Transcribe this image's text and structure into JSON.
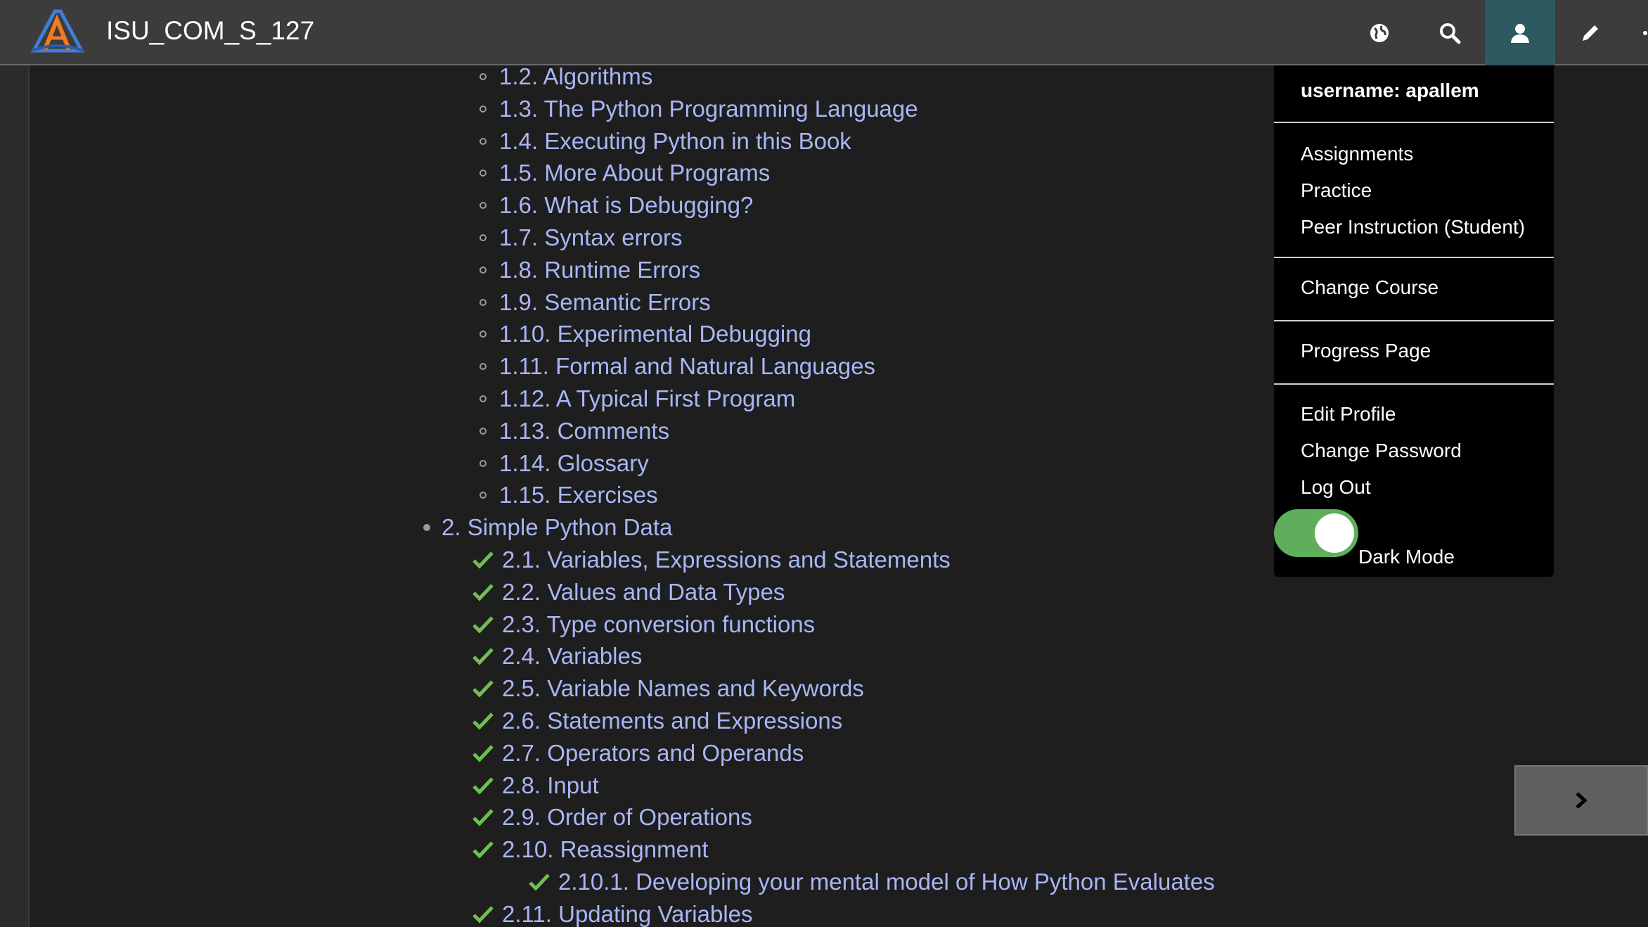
{
  "navbar": {
    "title": "ISU_COM_S_127",
    "icons": [
      "globe-icon",
      "search-icon",
      "user-icon",
      "pencil-icon",
      "moon-icon"
    ]
  },
  "toc": {
    "rows": [
      {
        "kind": "circle",
        "label": "1.2. Algorithms"
      },
      {
        "kind": "circle",
        "label": "1.3. The Python Programming Language"
      },
      {
        "kind": "circle",
        "label": "1.4. Executing Python in this Book"
      },
      {
        "kind": "circle",
        "label": "1.5. More About Programs"
      },
      {
        "kind": "circle",
        "label": "1.6. What is Debugging?"
      },
      {
        "kind": "circle",
        "label": "1.7. Syntax errors"
      },
      {
        "kind": "circle",
        "label": "1.8. Runtime Errors"
      },
      {
        "kind": "circle",
        "label": "1.9. Semantic Errors"
      },
      {
        "kind": "circle",
        "label": "1.10. Experimental Debugging"
      },
      {
        "kind": "circle",
        "label": "1.11. Formal and Natural Languages"
      },
      {
        "kind": "circle",
        "label": "1.12. A Typical First Program"
      },
      {
        "kind": "circle",
        "label": "1.13. Comments"
      },
      {
        "kind": "circle",
        "label": "1.14. Glossary"
      },
      {
        "kind": "circle",
        "label": "1.15. Exercises"
      },
      {
        "kind": "bullet",
        "label": "2. Simple Python Data"
      },
      {
        "kind": "check",
        "label": "2.1. Variables, Expressions and Statements"
      },
      {
        "kind": "check",
        "label": "2.2. Values and Data Types"
      },
      {
        "kind": "check",
        "label": "2.3. Type conversion functions"
      },
      {
        "kind": "check",
        "label": "2.4. Variables"
      },
      {
        "kind": "check",
        "label": "2.5. Variable Names and Keywords"
      },
      {
        "kind": "check",
        "label": "2.6. Statements and Expressions"
      },
      {
        "kind": "check",
        "label": "2.7. Operators and Operands"
      },
      {
        "kind": "check",
        "label": "2.8. Input"
      },
      {
        "kind": "check",
        "label": "2.9. Order of Operations"
      },
      {
        "kind": "check",
        "label": "2.10. Reassignment"
      },
      {
        "kind": "check2",
        "label": "2.10.1. Developing your mental model of How Python Evaluates"
      },
      {
        "kind": "check",
        "label": "2.11. Updating Variables"
      }
    ]
  },
  "dropdown": {
    "username": "username: apallem",
    "assignments": "Assignments",
    "practice": "Practice",
    "peer_instruction": "Peer Instruction (Student)",
    "change_course": "Change Course",
    "progress_page": "Progress Page",
    "edit_profile": "Edit Profile",
    "change_password": "Change Password",
    "log_out": "Log Out",
    "dark_mode": "Dark Mode",
    "dark_mode_on": true
  },
  "colors": {
    "link": "#a8b6f6",
    "check": "#6fbf4f",
    "toggle_on": "#5fae5b"
  }
}
